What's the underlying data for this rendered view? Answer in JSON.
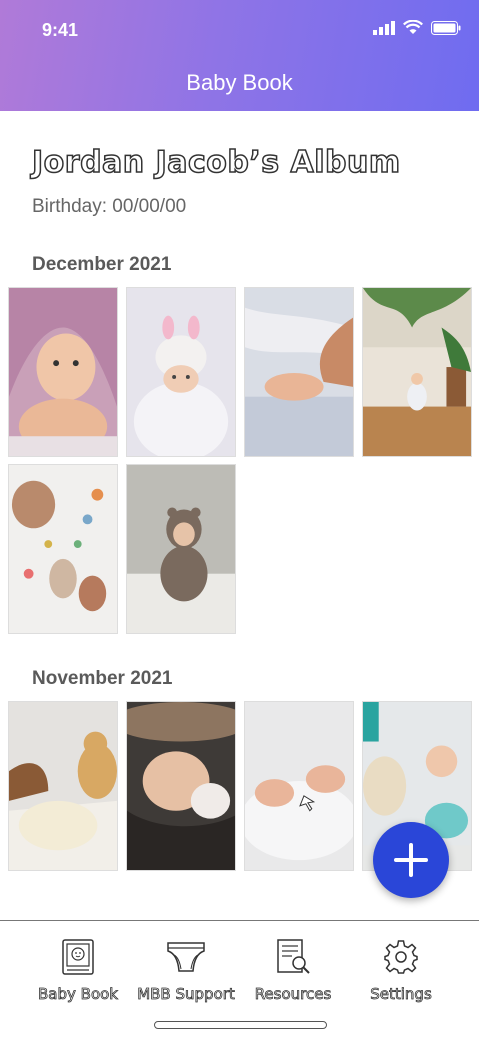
{
  "status_bar": {
    "time": "9:41"
  },
  "header": {
    "title": "Baby Book"
  },
  "album": {
    "title": "Jordan Jacob’s Album",
    "birthday": "Birthday: 00/00/00"
  },
  "sections": [
    {
      "label": "December 2021",
      "photo_count": 6
    },
    {
      "label": "November 2021",
      "photo_count": 4
    }
  ],
  "fab": {
    "icon": "plus-icon",
    "color": "#2a46d8"
  },
  "tabbar": {
    "items": [
      {
        "label": "Baby Book",
        "icon": "baby-book-icon"
      },
      {
        "label": "MBB Support",
        "icon": "diaper-icon"
      },
      {
        "label": "Resources",
        "icon": "document-search-icon"
      },
      {
        "label": "Settings",
        "icon": "gear-icon"
      }
    ]
  },
  "colors": {
    "header_start": "#b07ad8",
    "header_end": "#6f6cf0",
    "accent": "#2a46d8"
  }
}
